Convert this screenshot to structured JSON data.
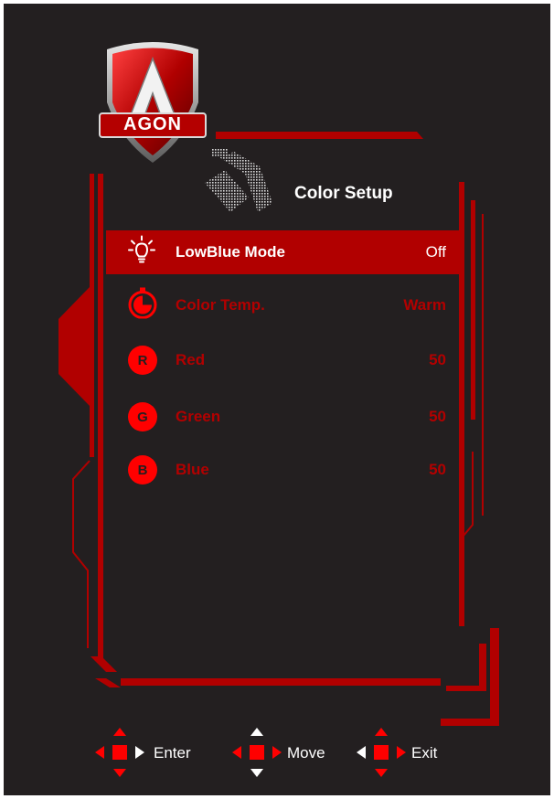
{
  "menu": {
    "title": "Color Setup",
    "brand": "AGON",
    "items": [
      {
        "label": "LowBlue Mode",
        "value": "Off",
        "icon": "lightbulb-icon",
        "selected": true
      },
      {
        "label": "Color Temp.",
        "value": "Warm",
        "icon": "color-temp-icon",
        "selected": false
      },
      {
        "label": "Red",
        "value": "50",
        "icon": "red-channel-icon",
        "badge": "R",
        "selected": false
      },
      {
        "label": "Green",
        "value": "50",
        "icon": "green-channel-icon",
        "badge": "G",
        "selected": false
      },
      {
        "label": "Blue",
        "value": "50",
        "icon": "blue-channel-icon",
        "badge": "B",
        "selected": false
      }
    ]
  },
  "hints": {
    "enter": "Enter",
    "move": "Move",
    "exit": "Exit"
  },
  "colors": {
    "background": "#231f20",
    "accent": "#b10000",
    "bright_red": "#ff0000",
    "dim_text": "#b30000",
    "text": "#ffffff"
  }
}
